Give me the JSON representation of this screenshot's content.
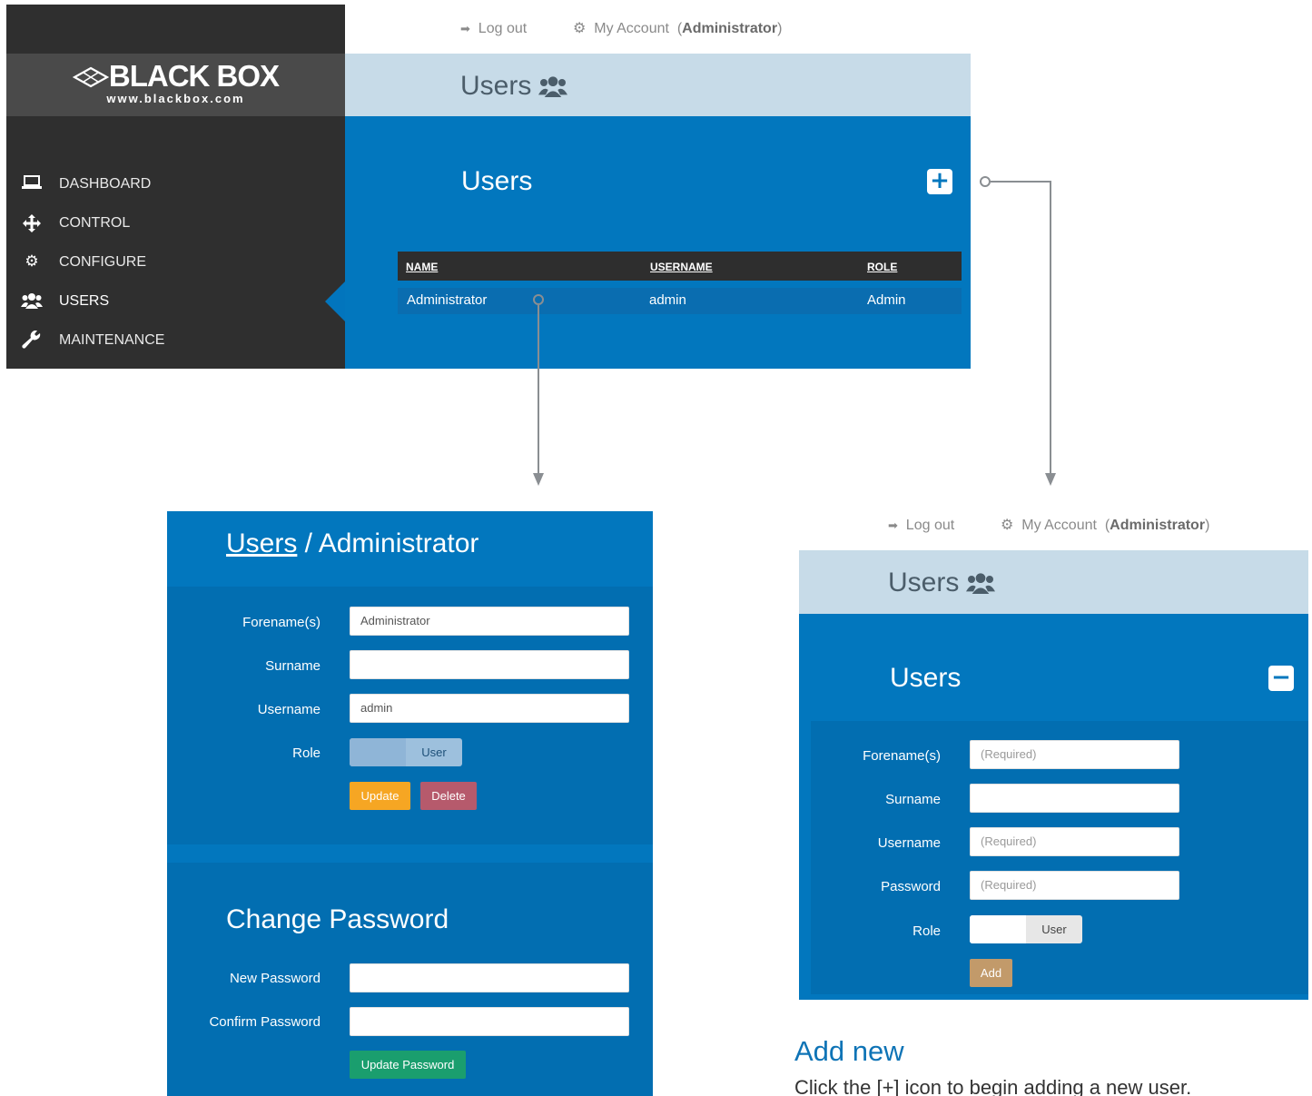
{
  "brand": {
    "name": "BLACK BOX",
    "url": "www.blackbox.com"
  },
  "top_screen": {
    "topbar": {
      "logout": "Log out",
      "my_account": "My Account",
      "account_user": "Administrator"
    },
    "title": "Users",
    "sidebar": {
      "items": [
        {
          "label": "DASHBOARD",
          "icon": "laptop-icon"
        },
        {
          "label": "CONTROL",
          "icon": "move-arrows-icon"
        },
        {
          "label": "CONFIGURE",
          "icon": "gears-icon"
        },
        {
          "label": "USERS",
          "icon": "users-icon",
          "active": true
        },
        {
          "label": "MAINTENANCE",
          "icon": "wrench-icon"
        }
      ]
    },
    "panel_title": "Users",
    "add_button": "+",
    "table": {
      "headers": [
        "NAME",
        "USERNAME",
        "ROLE"
      ],
      "rows": [
        {
          "name": "Administrator",
          "username": "admin",
          "role": "Admin"
        }
      ]
    }
  },
  "edit_screen": {
    "breadcrumb_link": "Users",
    "breadcrumb_sep": " / ",
    "breadcrumb_current": "Administrator",
    "fields": {
      "forename_label": "Forename(s)",
      "forename_value": "Administrator",
      "surname_label": "Surname",
      "surname_value": "",
      "username_label": "Username",
      "username_value": "admin",
      "role_label": "Role",
      "role_value": "User"
    },
    "update_button": "Update",
    "delete_button": "Delete",
    "change_password_title": "Change Password",
    "new_password_label": "New Password",
    "confirm_password_label": "Confirm Password",
    "update_password_button": "Update Password"
  },
  "add_screen": {
    "topbar": {
      "logout": "Log out",
      "my_account": "My Account",
      "account_user": "Administrator"
    },
    "title": "Users",
    "panel_title": "Users",
    "collapse_button": "−",
    "fields": {
      "forename_label": "Forename(s)",
      "forename_placeholder": "(Required)",
      "surname_label": "Surname",
      "surname_placeholder": "",
      "username_label": "Username",
      "username_placeholder": "(Required)",
      "password_label": "Password",
      "password_placeholder": "(Required)",
      "role_label": "Role",
      "role_value": "User"
    },
    "add_button": "Add"
  },
  "caption": {
    "title": "Add new",
    "text": "Click the [+] icon to begin adding a new user."
  },
  "colors": {
    "panel_blue": "#0277be",
    "sidebar": "#2f2f2f",
    "titlebar": "#c7dbe8",
    "update": "#f6a623",
    "delete": "#b65a6c",
    "update_password": "#1a9e6e",
    "add": "#c29a6a"
  }
}
